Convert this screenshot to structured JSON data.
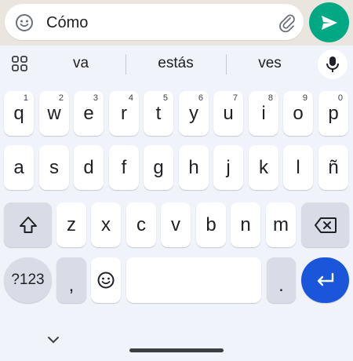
{
  "compose": {
    "message_text": "Cómo",
    "emoji_icon": "emoji-icon",
    "attach_icon": "paperclip-icon",
    "send_icon": "send-icon",
    "send_color": "#00a884"
  },
  "suggestions": {
    "items": [
      "va",
      "estás",
      "ves"
    ],
    "apps_icon": "grid-icon",
    "mic_icon": "microphone-icon"
  },
  "keyboard": {
    "row1": [
      {
        "ch": "q",
        "hint": "1"
      },
      {
        "ch": "w",
        "hint": "2"
      },
      {
        "ch": "e",
        "hint": "3"
      },
      {
        "ch": "r",
        "hint": "4"
      },
      {
        "ch": "t",
        "hint": "5"
      },
      {
        "ch": "y",
        "hint": "6"
      },
      {
        "ch": "u",
        "hint": "7"
      },
      {
        "ch": "i",
        "hint": "8"
      },
      {
        "ch": "o",
        "hint": "9"
      },
      {
        "ch": "p",
        "hint": "0"
      }
    ],
    "row2": [
      "a",
      "s",
      "d",
      "f",
      "g",
      "h",
      "j",
      "k",
      "l",
      "ñ"
    ],
    "row3": [
      "z",
      "x",
      "c",
      "v",
      "b",
      "n",
      "m"
    ],
    "shift_icon": "shift-icon",
    "backspace_icon": "backspace-icon",
    "symbols_label": "?123",
    "comma_label": ",",
    "emoji_key_icon": "emoji-icon",
    "period_label": ".",
    "enter_icon": "enter-icon",
    "enter_color": "#1a56d9"
  },
  "nav": {
    "collapse_icon": "chevron-down-icon"
  }
}
